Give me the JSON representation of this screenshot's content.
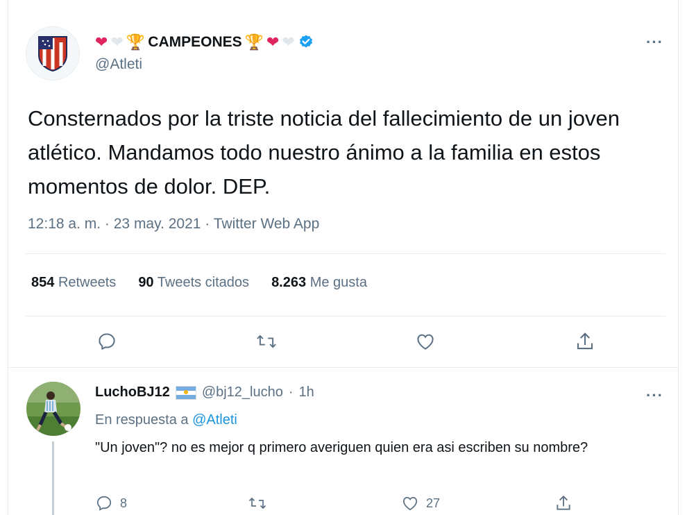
{
  "main_tweet": {
    "display_name": "CAMPEONES",
    "name_prefix_emojis": [
      "❤",
      "🤍",
      "🏆"
    ],
    "name_suffix_emojis": [
      "🏆",
      "❤",
      "🤍"
    ],
    "handle": "@Atleti",
    "text": "Consternados por la triste noticia del fallecimiento de un joven atlético. Mandamos todo nuestro ánimo a la familia en estos momentos de dolor. DEP.",
    "time": "12:18 a. m.",
    "separator": "·",
    "date": "23 may. 2021",
    "client": "Twitter Web App",
    "more_label": "···"
  },
  "stats": {
    "retweets_count": "854",
    "retweets_label": "Retweets",
    "quotes_count": "90",
    "quotes_label": "Tweets citados",
    "likes_count": "8.263",
    "likes_label": "Me gusta"
  },
  "reply": {
    "display_name": "LuchoBJ12",
    "flag": "🇦🇷",
    "handle": "@bj12_lucho",
    "separator": "·",
    "age": "1h",
    "in_reply_prefix": "En respuesta a",
    "in_reply_handle": "@Atleti",
    "text": "\"Un joven\"? no es mejor q primero averiguen quien era asi escriben su nombre?",
    "replies_count": "8",
    "likes_count": "27",
    "more_label": "···"
  },
  "icons": {
    "reply": "reply-icon",
    "retweet": "retweet-icon",
    "like": "heart-icon",
    "share": "share-icon",
    "verified": "verified-badge-icon"
  },
  "colors": {
    "accent": "#1da1f2",
    "link": "#1b95e0",
    "muted": "#5b7083",
    "heart_red": "#e0245e"
  }
}
